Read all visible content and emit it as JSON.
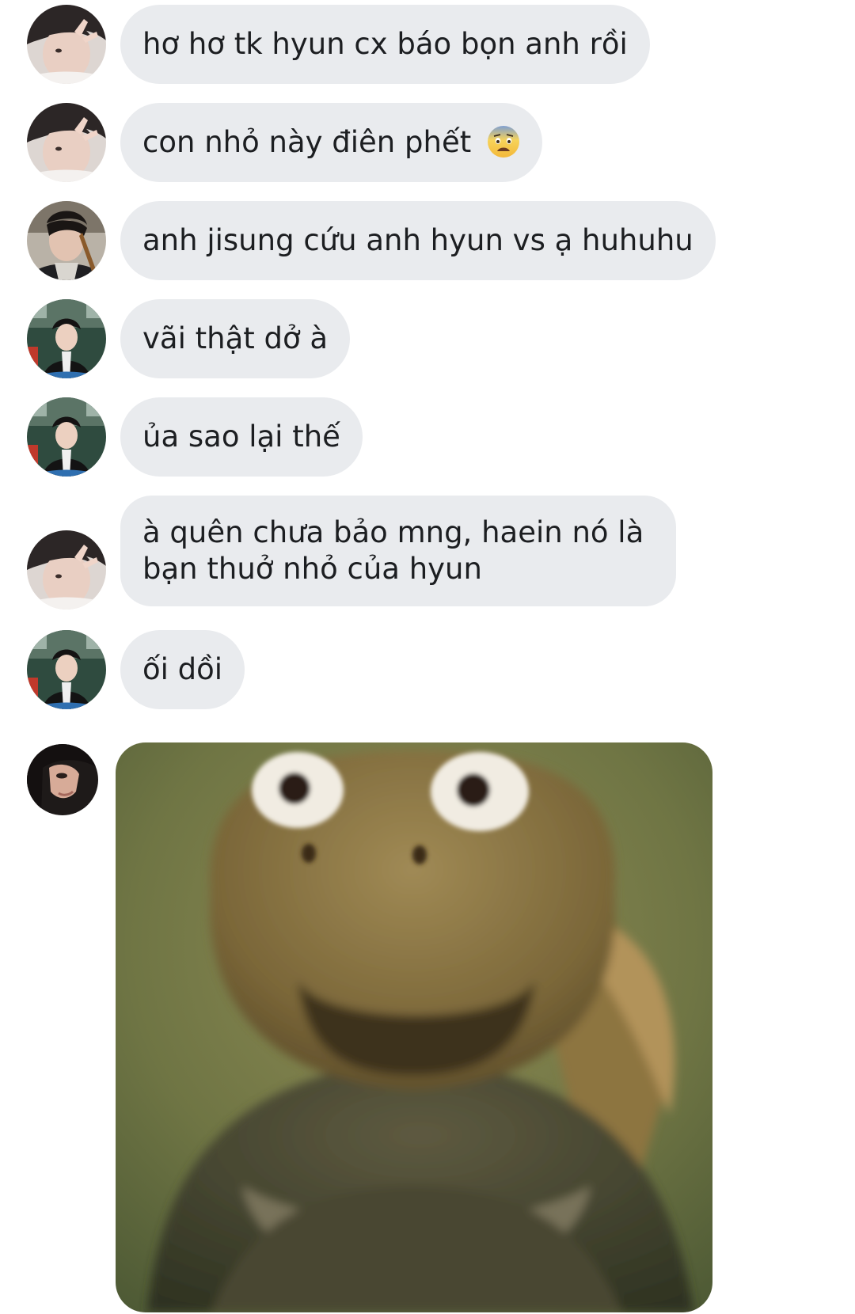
{
  "messages": [
    {
      "text": "hơ hơ tk hyun cx báo bọn anh rồi",
      "avatar": "avatar-peace-sign"
    },
    {
      "text": "con nhỏ này điên phết",
      "emoji": "anxious-face-emoji",
      "avatar": "avatar-peace-sign"
    },
    {
      "text": "anh jisung cứu anh hyun vs ạ huhuhu",
      "avatar": "avatar-guitar"
    },
    {
      "text": "vãi thật dở à",
      "avatar": "avatar-train"
    },
    {
      "text": "ủa sao lại thế",
      "avatar": "avatar-train"
    },
    {
      "lines": [
        "à quên chưa bảo mng, haein nó là",
        "bạn thuở nhỏ của hyun"
      ],
      "avatar": "avatar-peace-sign"
    },
    {
      "text": "ối dồi",
      "avatar": "avatar-train"
    }
  ],
  "image_message": {
    "avatar": "avatar-dark-hood",
    "image": "surprised-turtle-meme"
  },
  "colors": {
    "bubble": "#e9ebee",
    "text": "#1c1e21",
    "background": "#ffffff"
  }
}
